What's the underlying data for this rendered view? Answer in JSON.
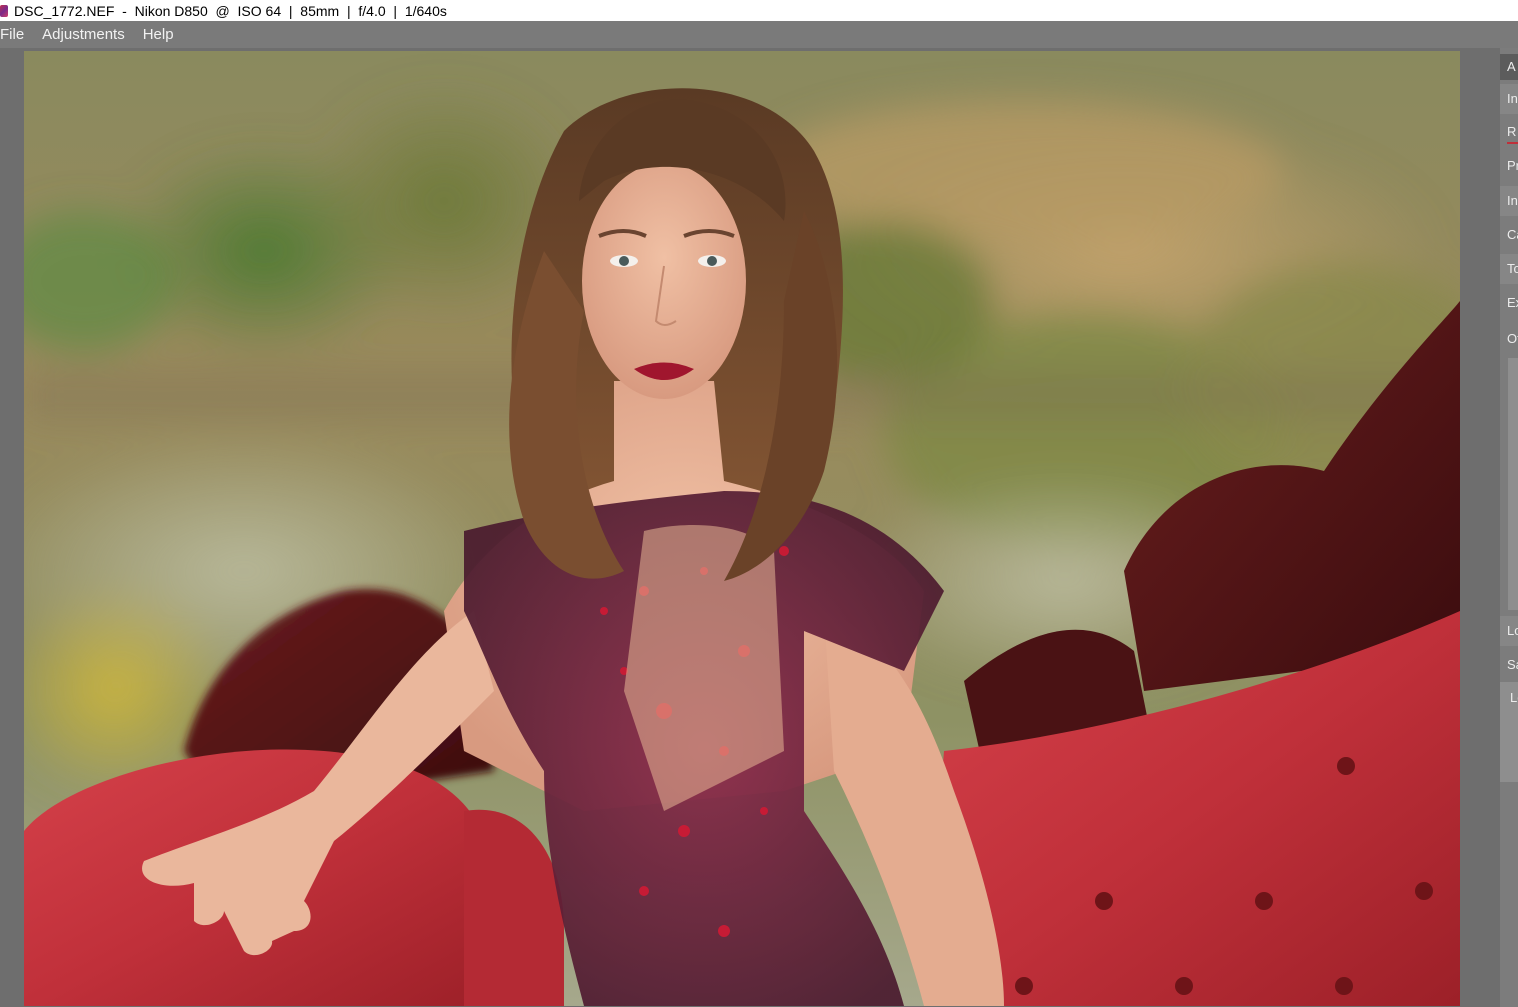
{
  "window": {
    "file_name": "DSC_1772.NEF",
    "camera": "Nikon D850",
    "iso": "ISO 64",
    "focal_length": "85mm",
    "aperture": "f/4.0",
    "shutter": "1/640s",
    "title": "DSC_1772.NEF  -  Nikon D850  @  ISO 64  |  85mm  |  f/4.0  |  1/640s"
  },
  "menu": {
    "items": [
      {
        "label": "File"
      },
      {
        "label": "Adjustments"
      },
      {
        "label": "Help"
      }
    ]
  },
  "right_panel": {
    "rows": [
      {
        "label": "A",
        "kind": "header"
      },
      {
        "label": "In",
        "kind": "section"
      },
      {
        "label": "R",
        "kind": "item-active"
      },
      {
        "label": "Pr",
        "kind": "item"
      },
      {
        "label": "In",
        "kind": "section"
      },
      {
        "label": "Ca",
        "kind": "item"
      },
      {
        "label": "To",
        "kind": "section"
      },
      {
        "label": "Ex",
        "kind": "item"
      },
      {
        "label": "Ot",
        "kind": "item"
      },
      {
        "label": "Lo",
        "kind": "section"
      },
      {
        "label": "Sa",
        "kind": "item"
      },
      {
        "label": "Lo",
        "kind": "item"
      }
    ]
  },
  "colors": {
    "accent_red": "#c0303a",
    "menubar_bg": "#7a7a7a",
    "workspace_bg": "#6e6e6e"
  }
}
